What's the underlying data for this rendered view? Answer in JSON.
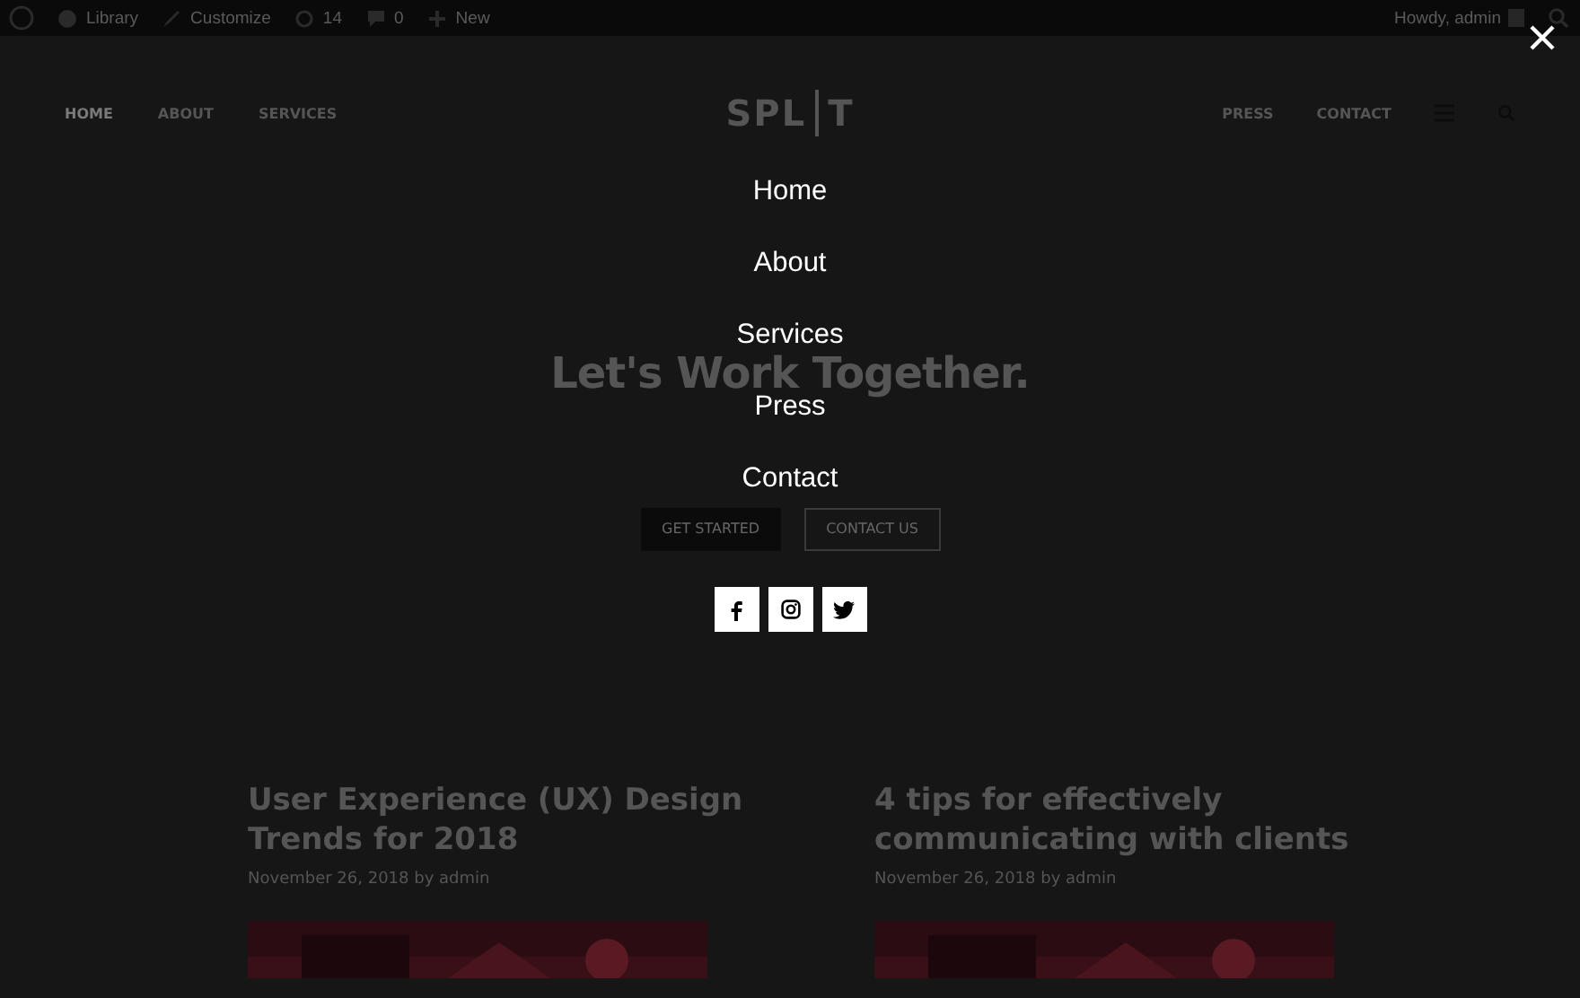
{
  "admin_bar": {
    "items": [
      {
        "kind": "wp"
      },
      {
        "kind": "site",
        "label": "Library"
      },
      {
        "kind": "customize",
        "label": "Customize"
      },
      {
        "kind": "updates",
        "label": "14"
      },
      {
        "kind": "comments",
        "label": "0"
      },
      {
        "kind": "new",
        "label": "New"
      }
    ],
    "greeting": "Howdy, admin"
  },
  "header": {
    "logo_left": "SPL",
    "logo_right": "T",
    "nav_left": [
      {
        "label": "HOME",
        "selected": true
      },
      {
        "label": "ABOUT",
        "selected": false
      },
      {
        "label": "SERVICES",
        "selected": false
      }
    ],
    "nav_right": [
      {
        "label": "PRESS",
        "selected": false
      },
      {
        "label": "CONTACT",
        "selected": false
      }
    ]
  },
  "hero": {
    "title": "Let's Work Together.",
    "buttons": [
      {
        "label": "GET STARTED",
        "kind": "primary"
      },
      {
        "label": "CONTACT US",
        "kind": "outline"
      }
    ]
  },
  "posts": [
    {
      "title": "User Experience (UX) Design Trends for 2018",
      "meta": "November 26, 2018 by admin"
    },
    {
      "title": "4 tips for effectively communicating with clients",
      "meta": "November 26, 2018 by admin"
    }
  ],
  "overlay_menu": {
    "items": [
      {
        "label": "Home"
      },
      {
        "label": "About"
      },
      {
        "label": "Services"
      },
      {
        "label": "Press"
      },
      {
        "label": "Contact"
      }
    ],
    "social": [
      {
        "kind": "facebook"
      },
      {
        "kind": "instagram"
      },
      {
        "kind": "twitter"
      }
    ]
  }
}
